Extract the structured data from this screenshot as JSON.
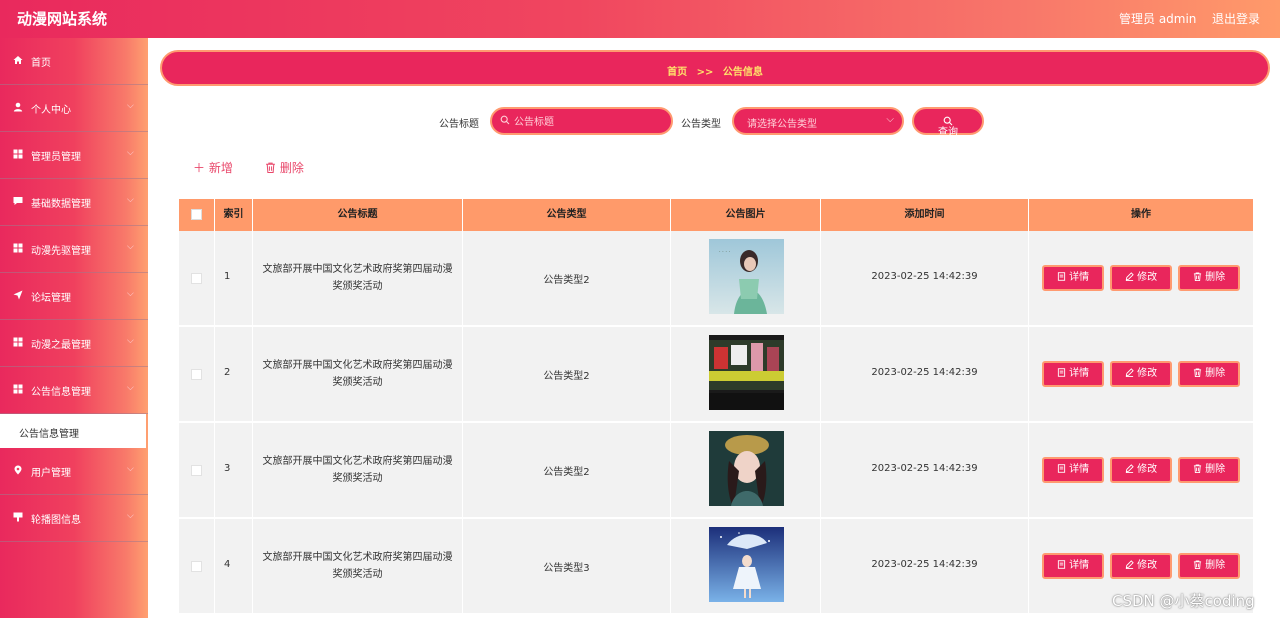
{
  "header": {
    "title": "动漫网站系统",
    "user": "管理员 admin",
    "logout": "退出登录"
  },
  "sidebar": {
    "items": [
      {
        "label": "首页",
        "icon": "home-icon",
        "chevron": false
      },
      {
        "label": "个人中心",
        "icon": "user-icon",
        "chevron": true
      },
      {
        "label": "管理员管理",
        "icon": "grid-icon",
        "chevron": true
      },
      {
        "label": "基础数据管理",
        "icon": "chat-icon",
        "chevron": true
      },
      {
        "label": "动漫先驱管理",
        "icon": "grid-icon",
        "chevron": true
      },
      {
        "label": "论坛管理",
        "icon": "send-icon",
        "chevron": true
      },
      {
        "label": "动漫之最管理",
        "icon": "grid-icon",
        "chevron": true
      },
      {
        "label": "公告信息管理",
        "icon": "grid-icon",
        "chevron": true
      },
      {
        "label": "用户管理",
        "icon": "pin-icon",
        "chevron": true
      },
      {
        "label": "轮播图信息",
        "icon": "banner-icon",
        "chevron": true
      }
    ],
    "active_submenu": "公告信息管理"
  },
  "breadcrumb": {
    "home": "首页",
    "separator": ">>",
    "current": "公告信息"
  },
  "search": {
    "title_label": "公告标题",
    "title_placeholder": "公告标题",
    "type_label": "公告类型",
    "type_placeholder": "请选择公告类型",
    "query_label": "查询"
  },
  "toolbar": {
    "add_label": "新增",
    "delete_label": "删除"
  },
  "table": {
    "columns": [
      "",
      "索引",
      "公告标题",
      "公告类型",
      "公告图片",
      "添加时间",
      "操作"
    ],
    "rows": [
      {
        "index": "1",
        "title": "文旅部开展中国文化艺术政府奖第四届动漫奖颁奖活动",
        "type": "公告类型2",
        "time": "2023-02-25 14:42:39"
      },
      {
        "index": "2",
        "title": "文旅部开展中国文化艺术政府奖第四届动漫奖颁奖活动",
        "type": "公告类型2",
        "time": "2023-02-25 14:42:39"
      },
      {
        "index": "3",
        "title": "文旅部开展中国文化艺术政府奖第四届动漫奖颁奖活动",
        "type": "公告类型2",
        "time": "2023-02-25 14:42:39"
      },
      {
        "index": "4",
        "title": "文旅部开展中国文化艺术政府奖第四届动漫奖颁奖活动",
        "type": "公告类型3",
        "time": "2023-02-25 14:42:39"
      }
    ],
    "actions": {
      "detail": "详情",
      "edit": "修改",
      "delete": "删除"
    }
  },
  "watermark": "CSDN @小蔡coding",
  "colors": {
    "primary": "#e9265c",
    "accent_border": "#ff9a70",
    "header_row": "#ff9a6a",
    "row_bg": "#f2f2f2"
  }
}
